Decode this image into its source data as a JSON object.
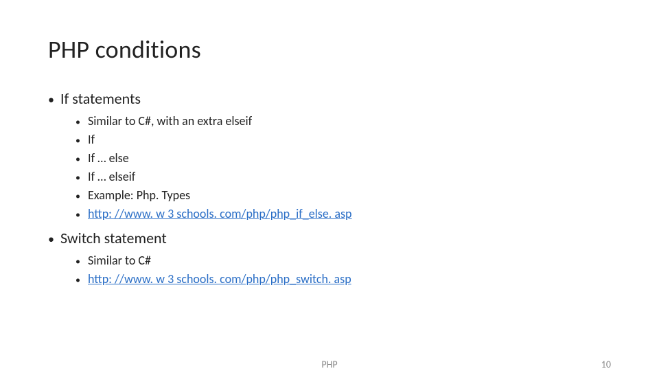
{
  "title": "PHP conditions",
  "sections": [
    {
      "label": "If statements",
      "items": [
        {
          "text": "Similar to C#, with an extra elseif",
          "link": false
        },
        {
          "text": "If",
          "link": false
        },
        {
          "text": "If … else",
          "link": false
        },
        {
          "text": "If … elseif",
          "link": false
        },
        {
          "text": "Example: Php. Types",
          "link": false
        },
        {
          "text": "http: //www. w 3 schools. com/php/php_if_else. asp",
          "link": true
        }
      ]
    },
    {
      "label": "Switch statement",
      "items": [
        {
          "text": "Similar to C#",
          "link": false
        },
        {
          "text": "http: //www. w 3 schools. com/php/php_switch. asp",
          "link": true
        }
      ]
    }
  ],
  "footer": {
    "center": "PHP",
    "page": "10"
  }
}
